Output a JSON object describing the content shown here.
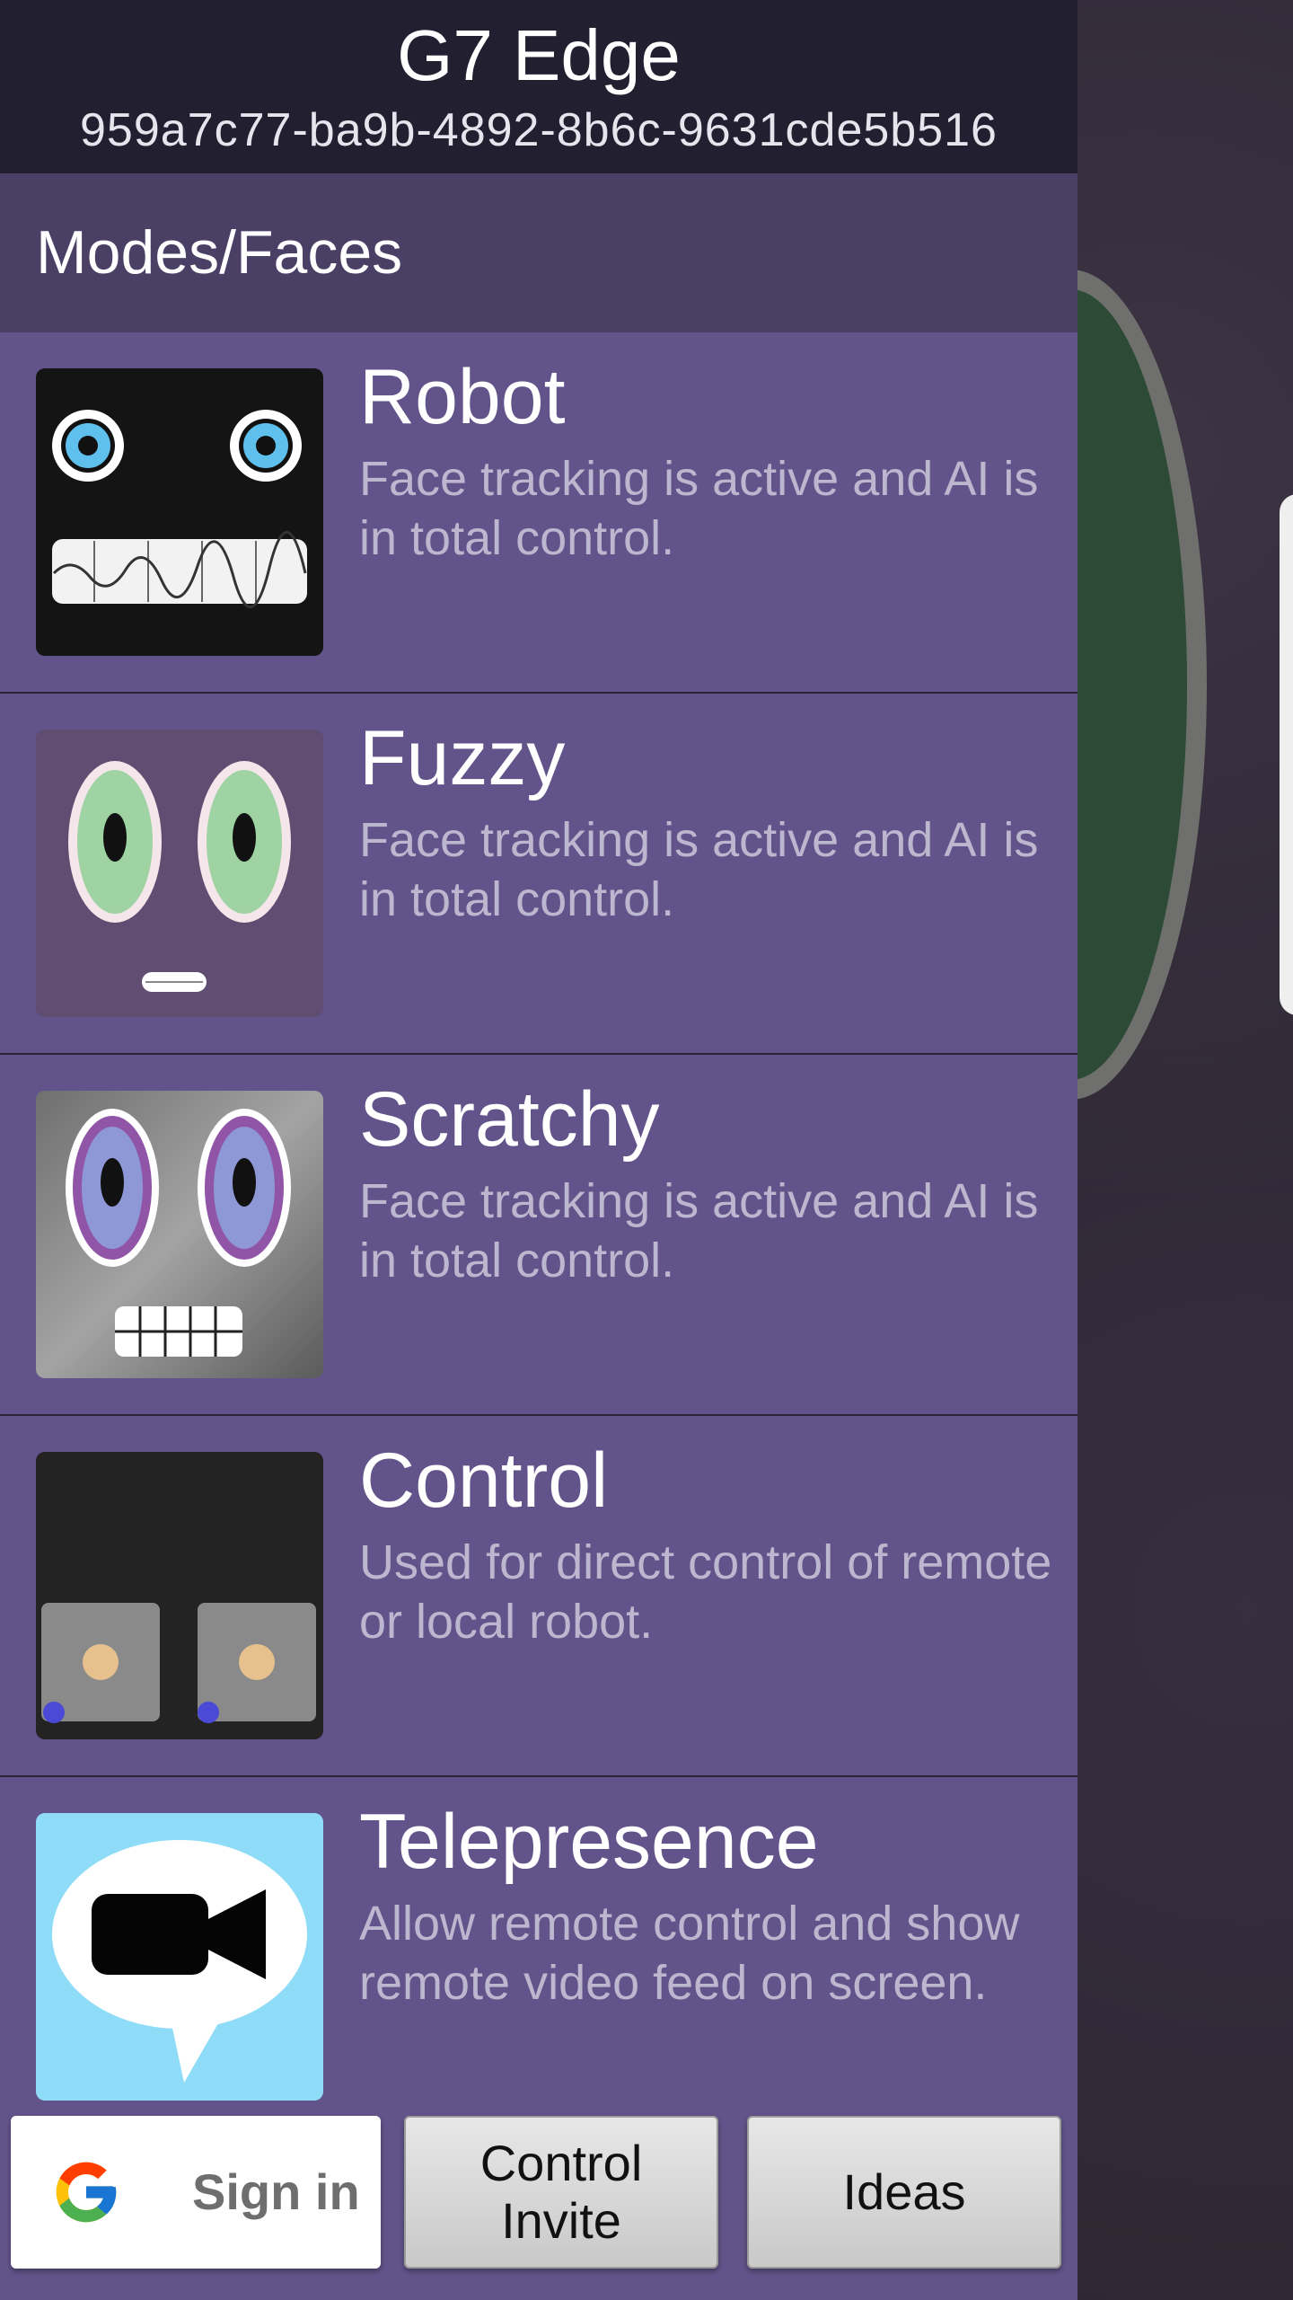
{
  "header": {
    "title": "G7 Edge",
    "subtitle": "959a7c77-ba9b-4892-8b6c-9631cde5b516"
  },
  "section": {
    "title": "Modes/Faces"
  },
  "modes": [
    {
      "title": "Robot",
      "description": "Face tracking is active and AI is in total control.",
      "icon": "robot-face-icon"
    },
    {
      "title": "Fuzzy",
      "description": "Face tracking is active and AI is in total control.",
      "icon": "fuzzy-face-icon"
    },
    {
      "title": "Scratchy",
      "description": "Face tracking is active and AI is in total control.",
      "icon": "scratchy-face-icon"
    },
    {
      "title": "Control",
      "description": "Used for direct control of remote or local robot.",
      "icon": "control-pad-icon"
    },
    {
      "title": "Telepresence",
      "description": "Allow remote control and show remote video feed on screen.",
      "icon": "video-chat-icon"
    }
  ],
  "buttons": {
    "signin_label": "Sign in",
    "control_invite_line1": "Control",
    "control_invite_line2": "Invite",
    "ideas_label": "Ideas"
  },
  "colors": {
    "drawer_background": "#62548a",
    "header_background": "#221f31",
    "section_header_background": "#4a4066"
  }
}
